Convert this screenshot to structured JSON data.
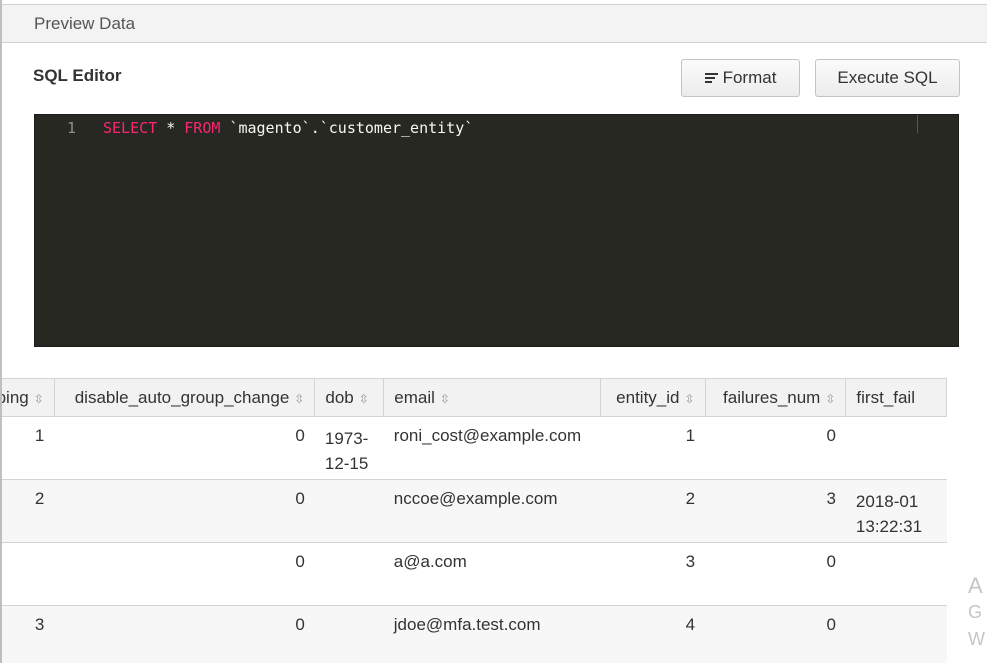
{
  "panel": {
    "title": "Preview Data"
  },
  "editor": {
    "title": "SQL Editor",
    "format_label": "Format",
    "execute_label": "Execute SQL",
    "line_number": "1",
    "code": {
      "kw_select": "SELECT",
      "star": " * ",
      "kw_from": "FROM",
      "rest": " `magento`.`customer_entity`"
    }
  },
  "table": {
    "columns": [
      "pping",
      "disable_auto_group_change",
      "dob",
      "email",
      "entity_id",
      "failures_num",
      "first_fail"
    ],
    "rows": [
      {
        "pping": "1",
        "disable_auto_group_change": "0",
        "dob": "1973-12-15",
        "dob_line1": "1973-",
        "dob_line2": "12-15",
        "email": "roni_cost@example.com",
        "entity_id": "1",
        "failures_num": "0",
        "first_fail_line1": "",
        "first_fail_line2": ""
      },
      {
        "pping": "2",
        "disable_auto_group_change": "0",
        "dob": "",
        "dob_line1": "",
        "dob_line2": "",
        "email": "nccoe@example.com",
        "entity_id": "2",
        "failures_num": "3",
        "first_fail_line1": "2018-01",
        "first_fail_line2": "13:22:31"
      },
      {
        "pping": "",
        "disable_auto_group_change": "0",
        "dob": "",
        "dob_line1": "",
        "dob_line2": "",
        "email": "a@a.com",
        "entity_id": "3",
        "failures_num": "0",
        "first_fail_line1": "",
        "first_fail_line2": ""
      },
      {
        "pping": "3",
        "disable_auto_group_change": "0",
        "dob": "",
        "dob_line1": "",
        "dob_line2": "",
        "email": "jdoe@mfa.test.com",
        "entity_id": "4",
        "failures_num": "0",
        "first_fail_line1": "",
        "first_fail_line2": ""
      }
    ]
  },
  "watermark": {
    "line1": "A",
    "line2": "G",
    "line3": "W"
  },
  "icons": {
    "format": "format-lines-icon",
    "sort": "sort-updown-icon"
  },
  "colors": {
    "editor_bg": "#272822",
    "keyword": "#f92672",
    "gutter": "#8f908a"
  }
}
